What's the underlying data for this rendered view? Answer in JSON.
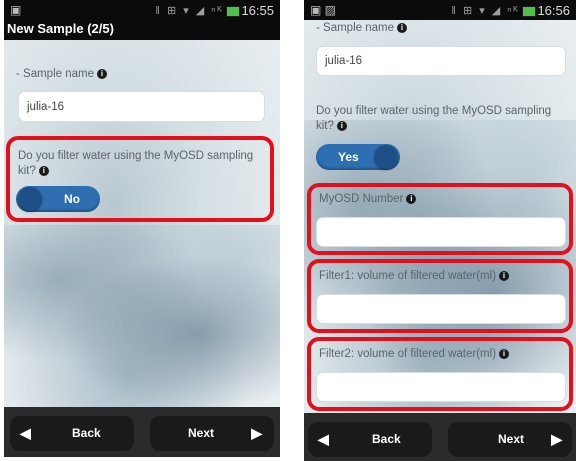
{
  "left_screen": {
    "status": {
      "time": "16:55"
    },
    "title": "New Sample (2/5)",
    "sample_name_label": "- Sample name",
    "sample_name_value": "julia-16",
    "filter_question": "Do you filter water using the MyOSD sampling kit?",
    "toggle_text": "No",
    "back_label": "Back",
    "next_label": "Next"
  },
  "right_screen": {
    "status": {
      "time": "16:56"
    },
    "sample_name_label": "- Sample name",
    "sample_name_value": "julia-16",
    "filter_question": "Do you filter water using the MyOSD sampling kit?",
    "toggle_text": "Yes",
    "myosd_number_label": "MyOSD Number",
    "myosd_number_value": "",
    "filter1_label": "Filter1: volume of filtered water(ml)",
    "filter1_value": "",
    "filter2_label": "Filter2: volume of filtered water(ml)",
    "filter2_value": "",
    "back_label": "Back",
    "next_label": "Next"
  },
  "icons": {
    "info": "info-icon",
    "back_arrow": "arrow-left-icon",
    "next_arrow": "arrow-right-icon"
  },
  "colors": {
    "highlight": "#e3101c",
    "toggle_on": "#2d6fb1",
    "toggle_knob": "#1e4f86",
    "bars": "#0b0b0b"
  }
}
